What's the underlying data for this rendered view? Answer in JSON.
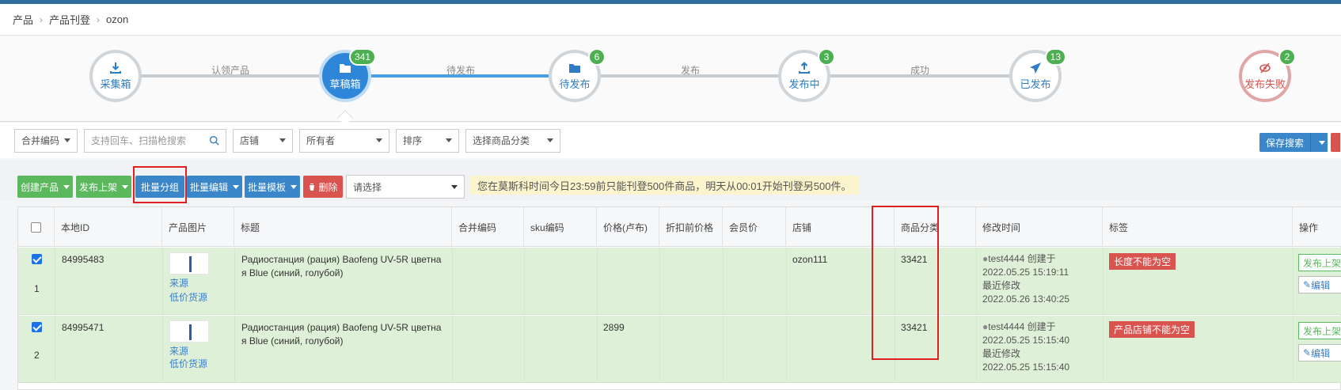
{
  "breadcrumb": [
    "产品",
    "产品刊登",
    "ozon"
  ],
  "workflow": {
    "steps": [
      {
        "label": "采集箱",
        "badge": ""
      },
      {
        "label": "草稿箱",
        "badge": "341"
      },
      {
        "label": "待发布",
        "badge": "6"
      },
      {
        "label": "发布中",
        "badge": "3"
      },
      {
        "label": "已发布",
        "badge": "13"
      },
      {
        "label": "发布失败",
        "badge": "2"
      }
    ],
    "connectors": [
      "认领产品",
      "待发布",
      "发布",
      "成功"
    ]
  },
  "filters": {
    "merge_code": "合并编码",
    "search_placeholder": "支持回车、扫描枪搜索",
    "shop": "店铺",
    "owner": "所有者",
    "sort": "排序",
    "category": "选择商品分类",
    "save_search": "保存搜索"
  },
  "actions": {
    "create": "创建产品",
    "publish": "发布上架",
    "batch_group": "批量分组",
    "batch_edit": "批量编辑",
    "batch_template": "批量模板",
    "delete": "删除",
    "select_placeholder": "请选择",
    "notice": "您在莫斯科时间今日23:59前只能刊登500件商品，明天从00:01开始刊登另500件。"
  },
  "table": {
    "headers": [
      "本地ID",
      "产品图片",
      "标题",
      "合并编码",
      "sku编码",
      "价格(卢布)",
      "折扣前价格",
      "会员价",
      "店铺",
      "商品分类",
      "修改时间",
      "标签",
      "操作"
    ],
    "rows": [
      {
        "index": "1",
        "id": "84995483",
        "source": "来源",
        "low_price": "低价货源",
        "title_line1": "Радиостанция (рация) Baofeng UV-5R цветна",
        "title_line2": "я Blue (синий, голубой)",
        "price": "",
        "shop": "ozon111",
        "category": "33421",
        "user": "test4444",
        "created_label": "创建于",
        "created": "2022.05.25 15:19:11",
        "modified_label": "最近修改",
        "modified": "2022.05.26 13:40:25",
        "tag": "长度不能为空",
        "op_publish": "发布上架",
        "op_edit": "编辑"
      },
      {
        "index": "2",
        "id": "84995471",
        "source": "来源",
        "low_price": "低价货源",
        "title_line1": "Радиостанция (рация) Baofeng UV-5R цветна",
        "title_line2": "я Blue (синий, голубой)",
        "price": "2899",
        "shop": "",
        "category": "33421",
        "user": "test4444",
        "created_label": "创建于",
        "created": "2022.05.25 15:15:40",
        "modified_label": "最近修改",
        "modified": "2022.05.25 15:15:40",
        "tag": "产品店铺不能为空",
        "op_publish": "发布上架",
        "op_edit": "编辑"
      }
    ]
  }
}
